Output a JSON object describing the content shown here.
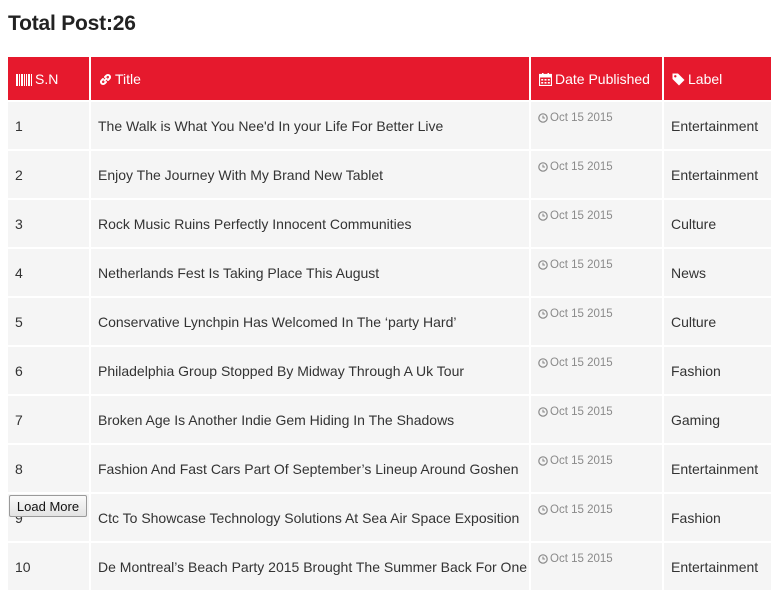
{
  "header": {
    "total_label": "Total Post:26"
  },
  "table": {
    "columns": [
      {
        "label": "S.N",
        "icon": "barcode-icon"
      },
      {
        "label": "Title",
        "icon": "link-icon"
      },
      {
        "label": "Date Published",
        "icon": "calendar-icon"
      },
      {
        "label": "Label",
        "icon": "tag-icon"
      }
    ],
    "rows": [
      {
        "sn": "1",
        "title": "The Walk is What You Nee'd In your Life For Better Live",
        "date": "Oct 15 2015",
        "label": "Entertainment"
      },
      {
        "sn": "2",
        "title": "Enjoy The Journey With My Brand New Tablet",
        "date": "Oct 15 2015",
        "label": "Entertainment"
      },
      {
        "sn": "3",
        "title": "Rock Music Ruins Perfectly Innocent Communities",
        "date": "Oct 15 2015",
        "label": "Culture"
      },
      {
        "sn": "4",
        "title": "Netherlands Fest Is Taking Place This August",
        "date": "Oct 15 2015",
        "label": "News"
      },
      {
        "sn": "5",
        "title": "Conservative Lynchpin Has Welcomed In The ‘party Hard’",
        "date": "Oct 15 2015",
        "label": "Culture"
      },
      {
        "sn": "6",
        "title": "Philadelphia Group Stopped By Midway Through A Uk Tour",
        "date": "Oct 15 2015",
        "label": "Fashion"
      },
      {
        "sn": "7",
        "title": "Broken Age Is Another Indie Gem Hiding In The Shadows",
        "date": "Oct 15 2015",
        "label": "Gaming"
      },
      {
        "sn": "8",
        "title": "Fashion And Fast Cars Part Of September’s Lineup Around Goshen",
        "date": "Oct 15 2015",
        "label": "Entertainment"
      },
      {
        "sn": "9",
        "title": "Ctc To Showcase Technology Solutions At Sea Air Space Exposition",
        "date": "Oct 15 2015",
        "label": "Fashion"
      },
      {
        "sn": "10",
        "title": "De Montreal’s Beach Party 2015 Brought The Summer Back For One",
        "date": "Oct 15 2015",
        "label": "Entertainment"
      }
    ]
  },
  "footer": {
    "load_more_label": "Load More"
  },
  "colors": {
    "header_bg": "#e6192d",
    "row_bg": "#f5f5f5",
    "header_text": "#ffffff"
  }
}
